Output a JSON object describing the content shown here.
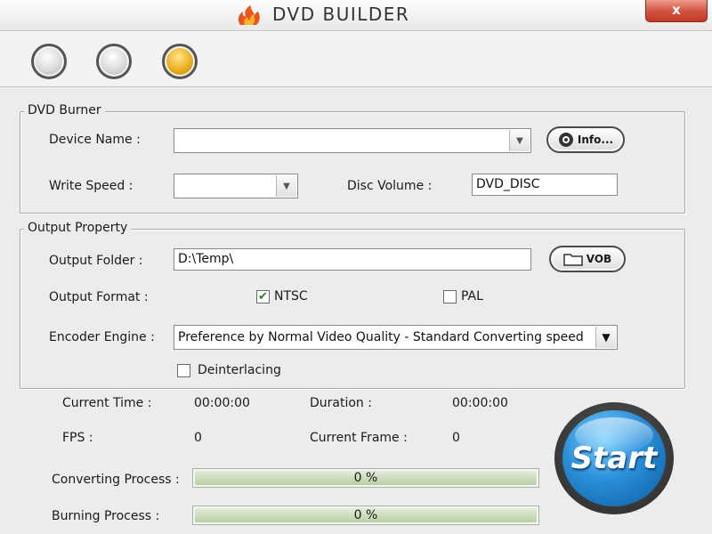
{
  "window": {
    "title": "DVD BUILDER",
    "close_label": "x",
    "logo_icon": "flame-logo"
  },
  "toolbar": {
    "buttons": [
      {
        "name": "step-1",
        "active": false
      },
      {
        "name": "step-2",
        "active": false
      },
      {
        "name": "step-3",
        "active": true
      }
    ]
  },
  "dvd_burner": {
    "legend": "DVD Burner",
    "device_name_label": "Device Name :",
    "device_name_value": "",
    "info_button_label": "Info...",
    "write_speed_label": "Write Speed :",
    "write_speed_value": "",
    "disc_volume_label": "Disc Volume :",
    "disc_volume_value": "DVD_DISC"
  },
  "output_property": {
    "legend": "Output Property",
    "output_folder_label": "Output Folder :",
    "output_folder_value": "D:\\Temp\\",
    "vob_button_label": "VOB",
    "output_format_label": "Output Format :",
    "ntsc_label": "NTSC",
    "ntsc_checked": true,
    "pal_label": "PAL",
    "pal_checked": false,
    "encoder_engine_label": "Encoder Engine :",
    "encoder_engine_value": "Preference by Normal Video Quality - Standard Converting speed",
    "deinterlacing_label": "Deinterlacing",
    "deinterlacing_checked": false
  },
  "status": {
    "current_time_label": "Current Time :",
    "current_time_value": "00:00:00",
    "duration_label": "Duration :",
    "duration_value": "00:00:00",
    "fps_label": "FPS :",
    "fps_value": "0",
    "current_frame_label": "Current Frame :",
    "current_frame_value": "0",
    "converting_label": "Converting Process :",
    "converting_percent": 0,
    "converting_text": "0 %",
    "burning_label": "Burning Process :",
    "burning_percent": 0,
    "burning_text": "0 %"
  },
  "start_button_label": "Start",
  "colors": {
    "close": "#d0503e",
    "active_step": "#e8aa1a",
    "start": "#2a8fd8",
    "progress": "#b8cfa5"
  }
}
